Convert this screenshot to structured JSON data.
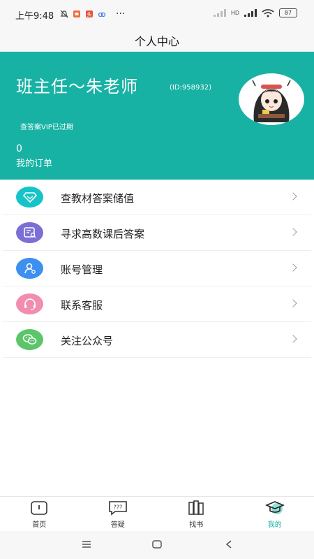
{
  "status_bar": {
    "time": "上午9:48",
    "network": "HD",
    "battery": "87"
  },
  "header": {
    "title": "个人中心"
  },
  "profile": {
    "name": "班主任～朱老师",
    "id_text": "(ID:958932)",
    "vip_status": "查答案VIP已过期",
    "order_count": "0",
    "order_label": "我的订单"
  },
  "menu": {
    "items": [
      {
        "label": "查教材答案储值",
        "icon": "diamond-icon",
        "color": "#16c4c8"
      },
      {
        "label": "寻求高数课后答案",
        "icon": "search-document-icon",
        "color": "#7b6fd6"
      },
      {
        "label": "账号管理",
        "icon": "user-settings-icon",
        "color": "#3d8ff0"
      },
      {
        "label": "联系客服",
        "icon": "headset-icon",
        "color": "#f28db0"
      },
      {
        "label": "关注公众号",
        "icon": "wechat-icon",
        "color": "#5cc56a"
      }
    ]
  },
  "tabbar": {
    "tabs": [
      {
        "label": "首页",
        "icon": "home-icon"
      },
      {
        "label": "答疑",
        "icon": "chat-question-icon"
      },
      {
        "label": "找书",
        "icon": "books-icon"
      },
      {
        "label": "我的",
        "icon": "graduation-cap-icon",
        "active": true
      }
    ]
  },
  "colors": {
    "accent": "#17b2a4"
  }
}
